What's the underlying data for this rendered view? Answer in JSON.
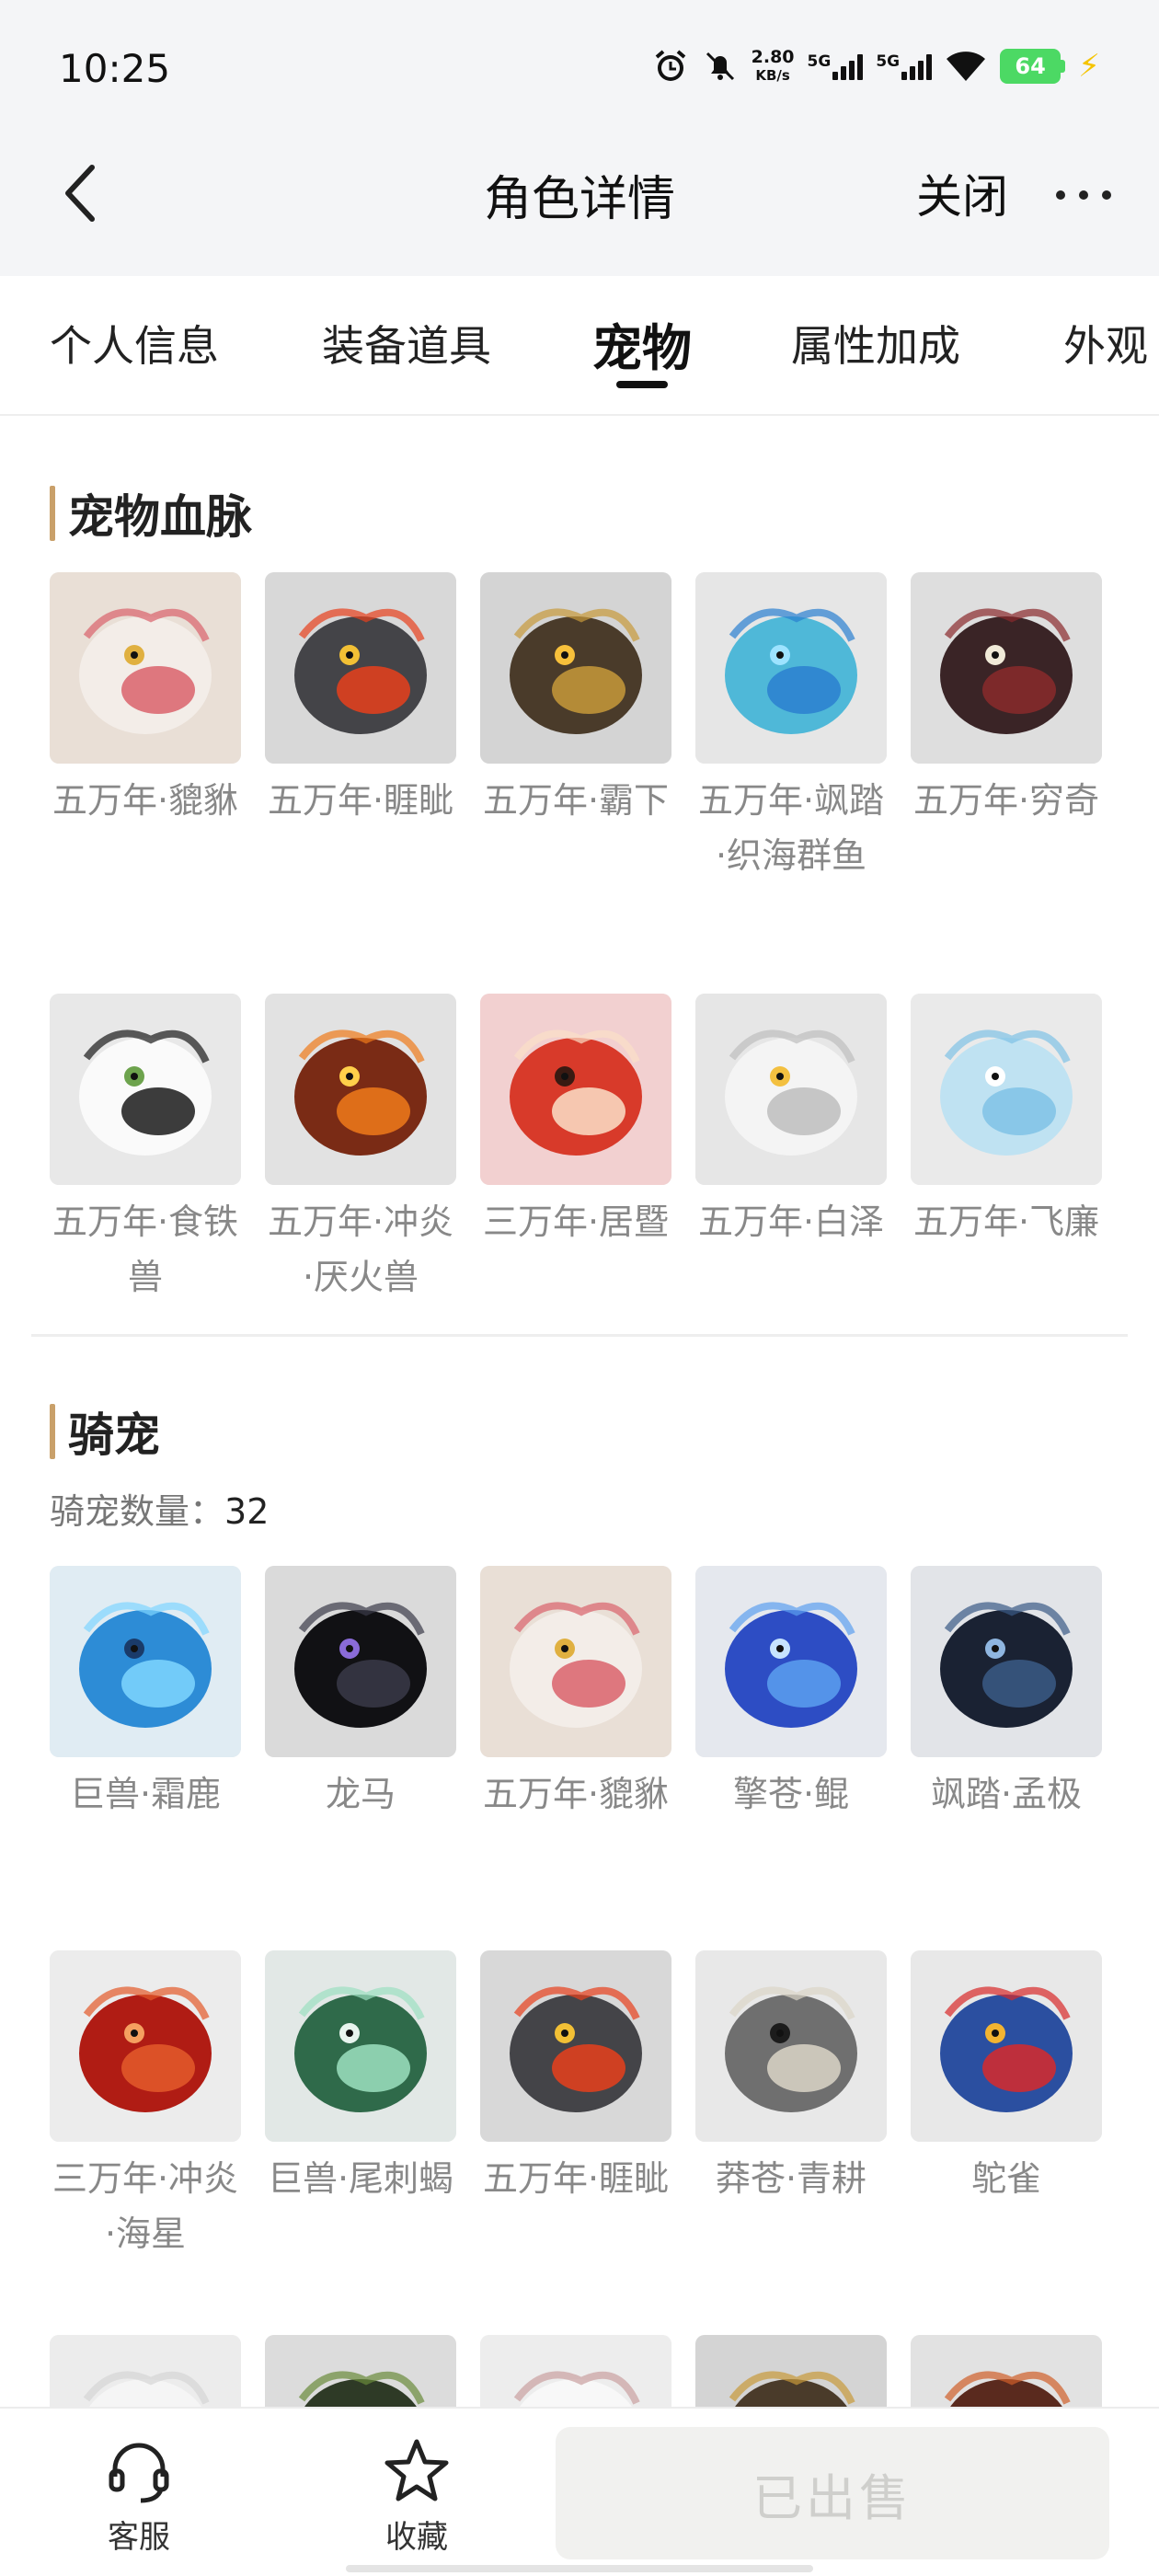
{
  "status": {
    "time": "10:25",
    "net_speed_value": "2.80",
    "net_speed_unit": "KB/s",
    "sig1": "5G",
    "sig2": "5G",
    "battery": "64"
  },
  "header": {
    "title": "角色详情",
    "close_label": "关闭"
  },
  "tabs": [
    "个人信息",
    "装备道具",
    "宠物",
    "属性加成",
    "外观"
  ],
  "active_tab": "宠物",
  "pet_section": {
    "title": "宠物血脉",
    "items": [
      {
        "label": "五万年·貔貅",
        "icon": "pixiu-lion-icon"
      },
      {
        "label": "五万年·睚眦",
        "icon": "dragon-red-eye-icon"
      },
      {
        "label": "五万年·霸下",
        "icon": "golden-beast-icon"
      },
      {
        "label": "五万年·飒踏·织海群鱼",
        "icon": "flying-fish-icon"
      },
      {
        "label": "五万年·穷奇",
        "icon": "tusk-beast-icon"
      },
      {
        "label": "五万年·食铁兽",
        "icon": "panda-icon"
      },
      {
        "label": "五万年·冲炎·厌火兽",
        "icon": "fire-beast-icon"
      },
      {
        "label": "三万年·居暨",
        "icon": "red-fox-icon"
      },
      {
        "label": "五万年·白泽",
        "icon": "white-cat-icon"
      },
      {
        "label": "五万年·飞廉",
        "icon": "ice-bird-icon"
      }
    ]
  },
  "mount_section": {
    "title": "骑宠",
    "count_label": "骑宠数量：",
    "count_value": "32",
    "items": [
      {
        "label": "巨兽·霜鹿",
        "icon": "ice-dragon-icon"
      },
      {
        "label": "龙马",
        "icon": "black-dragon-icon"
      },
      {
        "label": "五万年·貔貅",
        "icon": "pixiu-lion-icon"
      },
      {
        "label": "擎苍·鲲",
        "icon": "blue-whale-icon"
      },
      {
        "label": "飒踏·孟极",
        "icon": "dark-bird-icon"
      },
      {
        "label": "三万年·冲炎·海星",
        "icon": "starfish-icon"
      },
      {
        "label": "巨兽·尾刺蝎",
        "icon": "scorpion-icon"
      },
      {
        "label": "五万年·睚眦",
        "icon": "dragon-red-eye-icon"
      },
      {
        "label": "莽苍·青耕",
        "icon": "grey-bird-icon"
      },
      {
        "label": "鸵雀",
        "icon": "eagle-icon"
      },
      {
        "label": "",
        "icon": "white-deer-icon"
      },
      {
        "label": "",
        "icon": "green-beast-icon"
      },
      {
        "label": "",
        "icon": "white-monkey-icon"
      },
      {
        "label": "",
        "icon": "golden-beast-icon"
      },
      {
        "label": "",
        "icon": "red-wolf-icon"
      }
    ]
  },
  "bottom_bar": {
    "service_label": "客服",
    "favorite_label": "收藏",
    "sold_label": "已出售"
  }
}
